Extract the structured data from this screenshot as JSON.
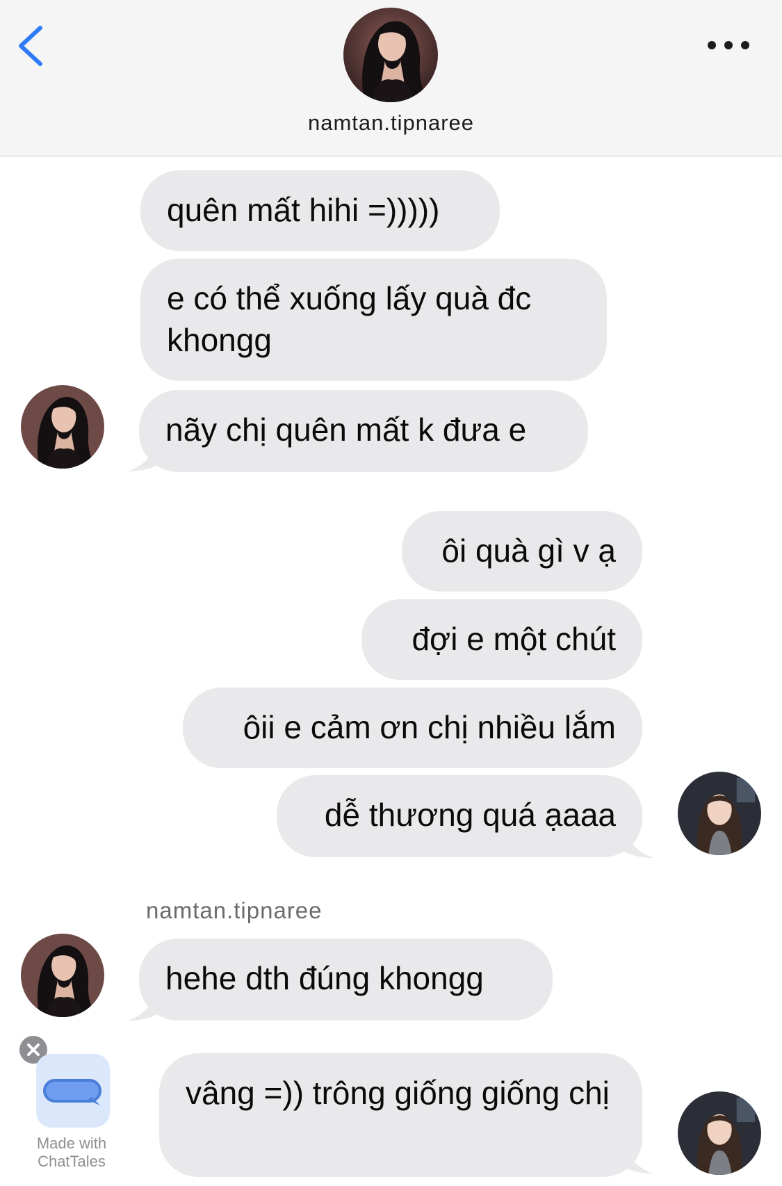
{
  "header": {
    "back_icon": "chevron-left-icon",
    "more_icon": "ellipsis-icon",
    "contact_name": "namtan.tipnaree",
    "accent_color": "#2f7cf6"
  },
  "messages": [
    {
      "side": "received",
      "text": "quên mất hihi =)))))"
    },
    {
      "side": "received",
      "text": "e có thể xuống lấy quà đc khongg"
    },
    {
      "side": "received",
      "text": "nãy chị quên mất k đưa e"
    },
    {
      "side": "sent",
      "text": "ôi quà gì v ạ"
    },
    {
      "side": "sent",
      "text": "đợi e một chút"
    },
    {
      "side": "sent",
      "text": "ôii e cảm ơn chị nhiều lắm"
    },
    {
      "side": "sent",
      "text": "dễ thương quá ạaaa"
    },
    {
      "side": "received",
      "sender": "namtan.tipnaree",
      "text": "hehe dth đúng khongg"
    },
    {
      "side": "sent",
      "text": "vâng =)) trông giống giống chị"
    }
  ],
  "badge": {
    "line1": "Made with",
    "line2": "ChatTales"
  },
  "colors": {
    "bubble": "#e9e9eb",
    "header_bg": "#f5f5f6"
  }
}
